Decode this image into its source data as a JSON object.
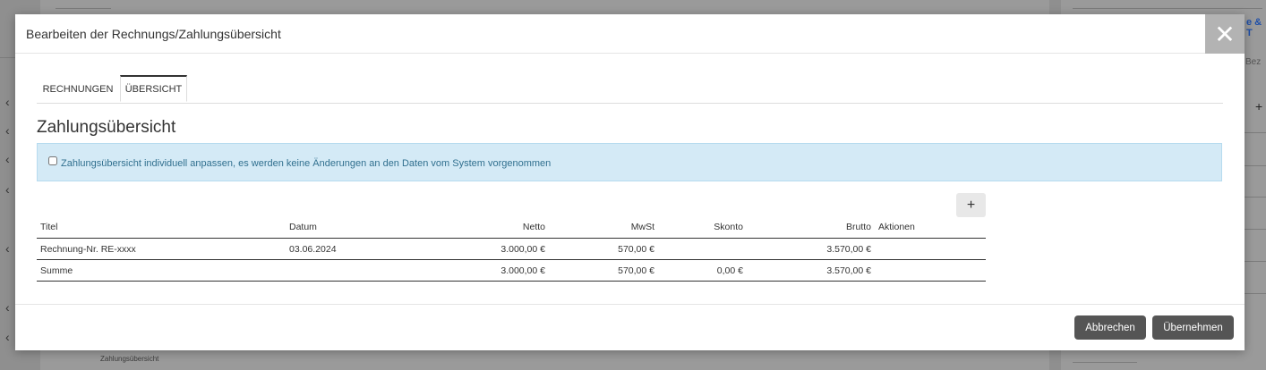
{
  "background": {
    "right_link": "e & T",
    "right_header": "Bez",
    "bottom_label": "Zahlungsübersicht",
    "plus": "+"
  },
  "modal": {
    "title": "Bearbeiten der Rechnungs/Zahlungsübersicht",
    "close_glyph": "✕"
  },
  "tabs": [
    {
      "label": "RECHNUNGEN",
      "active": false
    },
    {
      "label": "ÜBERSICHT",
      "active": true
    }
  ],
  "section": {
    "title": "Zahlungsübersicht"
  },
  "alert": {
    "checkbox_checked": false,
    "text": "Zahlungsübersicht individuell anpassen, es werden keine Änderungen an den Daten vom System vorgenommen"
  },
  "table": {
    "add_label": "+",
    "headers": {
      "titel": "Titel",
      "datum": "Datum",
      "netto": "Netto",
      "mwst": "MwSt",
      "skonto": "Skonto",
      "brutto": "Brutto",
      "aktionen": "Aktionen"
    },
    "rows": [
      {
        "titel": "Rechnung-Nr. RE-xxxx",
        "datum": "03.06.2024",
        "netto": "3.000,00 €",
        "mwst": "570,00 €",
        "skonto": "",
        "brutto": "3.570,00 €",
        "aktionen": ""
      }
    ],
    "sum": {
      "titel": "Summe",
      "datum": "",
      "netto": "3.000,00 €",
      "mwst": "570,00 €",
      "skonto": "0,00 €",
      "brutto": "3.570,00 €",
      "aktionen": ""
    }
  },
  "footer": {
    "cancel_label": "Abbrechen",
    "apply_label": "Übernehmen"
  },
  "colors": {
    "overlay": "#8f8f8f",
    "alert_bg": "#d4eaf6",
    "alert_text": "#31708f",
    "button_dark": "#555555",
    "close_bg": "#b3b3b3"
  }
}
